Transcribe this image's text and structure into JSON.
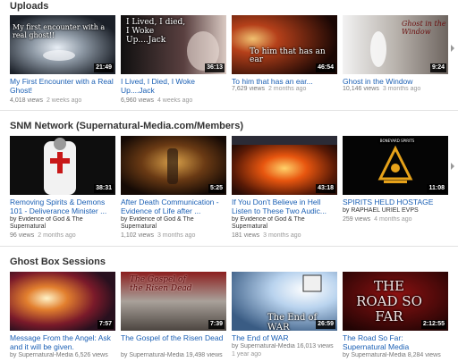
{
  "sections": [
    {
      "title": "Uploads",
      "videos": [
        {
          "title": "My First Encounter with a Real Ghost!",
          "duration": "21:49",
          "by": "",
          "views": "4,018 views",
          "ago": "2 weeks ago",
          "overlay": "My first encounter with a real ghost!!"
        },
        {
          "title": "I Lived, I Died, I Woke Up....Jack",
          "duration": "36:13",
          "by": "",
          "views": "6,960 views",
          "ago": "4 weeks ago",
          "overlay": "I Lived, I died, I Woke Up....Jack"
        },
        {
          "title": "To him that has an ear...",
          "duration": "46:54",
          "by": "",
          "views": "7,629 views",
          "ago": "2 months ago",
          "overlay": "To him that has an ear"
        },
        {
          "title": "Ghost in the Window",
          "duration": "9:24",
          "by": "",
          "views": "10,146 views",
          "ago": "3 months ago",
          "overlay": "Ghost in the Window"
        }
      ]
    },
    {
      "title": "SNM Network (Supernatural-Media.com/Members)",
      "videos": [
        {
          "title": "Removing Spirits & Demons 101 - Deliverance Minister ...",
          "duration": "38:31",
          "by": "by Evidence of God & The Supernatural",
          "views": "96 views",
          "ago": "2 months ago",
          "overlay": ""
        },
        {
          "title": "After Death Communication - Evidence of Life after ...",
          "duration": "5:25",
          "by": "by Evidence of God & The Supernatural",
          "views": "1,102 views",
          "ago": "3 months ago",
          "overlay": ""
        },
        {
          "title": "If You Don't Believe in Hell Listen to These Two Audic...",
          "duration": "43:18",
          "by": "by Evidence of God & The Supernatural",
          "views": "181 views",
          "ago": "3 months ago",
          "overlay": ""
        },
        {
          "title": "SPIRITS HELD HOSTAGE",
          "duration": "11:08",
          "by": "by RAPHAEL URIEL EVPS",
          "views": "259 views",
          "ago": "4 months ago",
          "overlay": "BONEYARD SPIRITS"
        }
      ]
    },
    {
      "title": "Ghost Box Sessions",
      "videos": [
        {
          "title": "Message From the Angel: Ask and it will be given.",
          "duration": "7:57",
          "by": "",
          "views": "",
          "ago": "",
          "byview": "by Supernatural-Media  6,526 views",
          "overlay": ""
        },
        {
          "title": "The Gospel of the Risen Dead",
          "duration": "7:39",
          "by": "",
          "views": "",
          "ago": "",
          "byview": "by Supernatural-Media  19,498 views",
          "overlay": "The Gospel of the Risen Dead"
        },
        {
          "title": "The End of WAR",
          "duration": "26:59",
          "by": "",
          "views": "",
          "ago": "",
          "byview": "by Supernatural-Media  16,013 views",
          "agoline": "1 year ago",
          "overlay": "The End of WAR"
        },
        {
          "title": "The Road So Far: Supernatural Media",
          "duration": "2:12:55",
          "by": "",
          "views": "",
          "ago": "",
          "byview": "by Supernatural-Media  8,284 views",
          "overlay": "THE ROAD SO FAR"
        }
      ]
    }
  ],
  "icons": {
    "next": "chevron-right-icon"
  }
}
